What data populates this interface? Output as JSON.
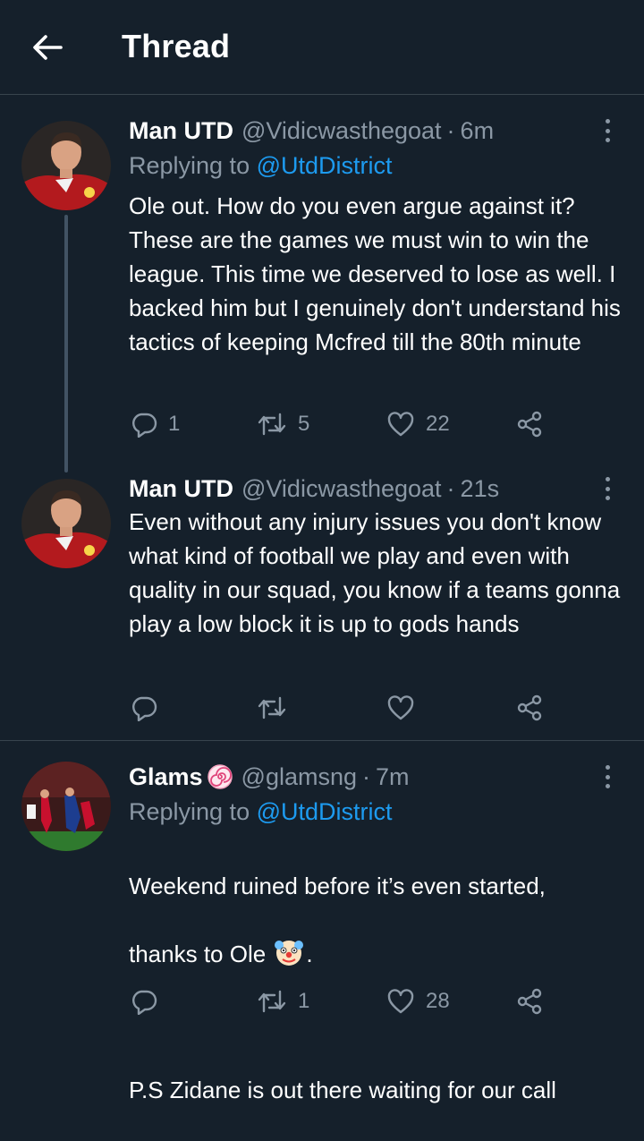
{
  "header": {
    "title": "Thread"
  },
  "tweets": [
    {
      "name": "Man UTD",
      "handle": "@Vidicwasthegoat",
      "separator": "·",
      "time": "6m",
      "reply_prefix": "Replying to ",
      "reply_to": "@UtdDistrict",
      "text": "Ole out. How do you even argue against it? These are the games we must win to win the league. This time we deserved to lose as well. I backed him but I genuinely don't understand his tactics of keeping Mcfred till the 80th minute",
      "replies": "1",
      "retweets": "5",
      "likes": "22"
    },
    {
      "name": "Man UTD",
      "handle": "@Vidicwasthegoat",
      "separator": "·",
      "time": "21s",
      "text": "Even without any injury issues you don't know what kind of football we play and even with quality in our squad, you know if a teams gonna play a low block it is up to gods hands",
      "replies": "",
      "retweets": "",
      "likes": ""
    },
    {
      "name": "Glams",
      "name_badge": "🍥",
      "handle": "@glamsng",
      "separator": "·",
      "time": "7m",
      "reply_prefix": "Replying to ",
      "reply_to": "@UtdDistrict",
      "text_line1": "Weekend ruined before it’s even started,",
      "text_line2a": "thanks to Ole ",
      "text_emoji": "🤡",
      "text_line2b": ".",
      "text_line3": "P.S Zidane is out there waiting for our call",
      "replies": "",
      "retweets": "1",
      "likes": "28"
    }
  ],
  "icons": {
    "back": "arrow-left-icon",
    "more": "more-vertical-icon",
    "reply": "reply-icon",
    "retweet": "retweet-icon",
    "like": "heart-icon",
    "share": "share-icon"
  },
  "colors": {
    "background": "#15202b",
    "divider": "#38444d",
    "secondary_text": "#8b98a5",
    "link": "#1d9bf0",
    "thread_line": "#425364"
  }
}
